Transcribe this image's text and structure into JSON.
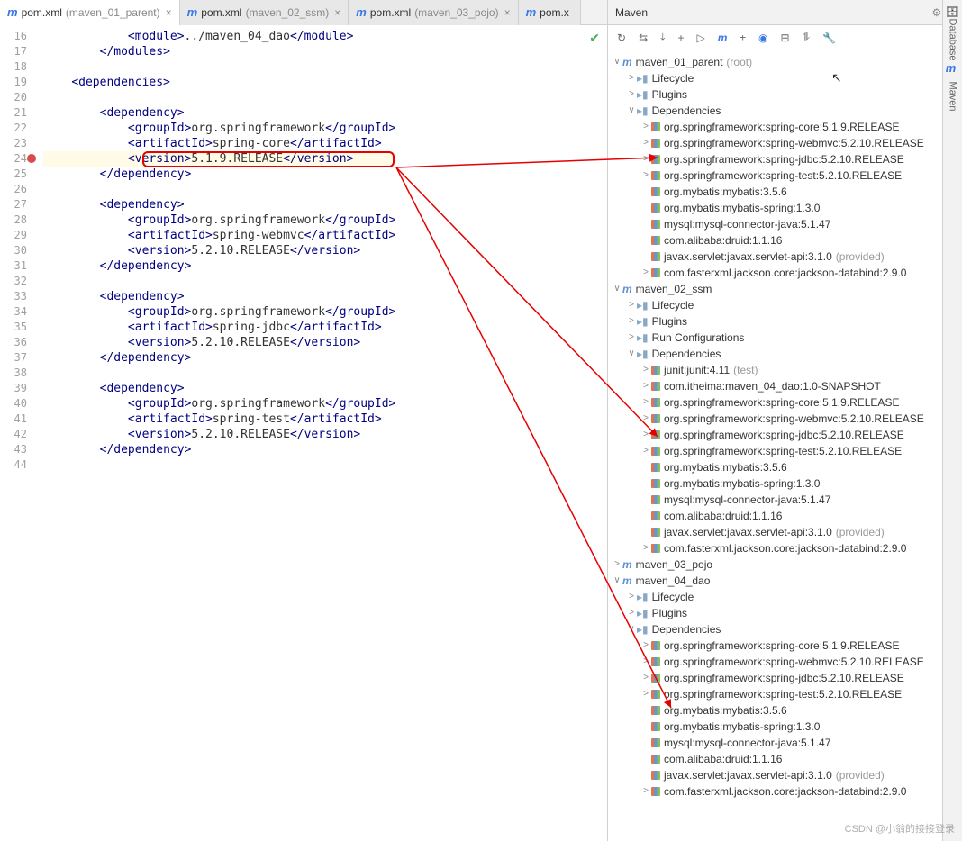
{
  "editor": {
    "tabs": [
      {
        "label": "pom.xml",
        "sub": "(maven_01_parent)",
        "active": true
      },
      {
        "label": "pom.xml",
        "sub": "(maven_02_ssm)",
        "active": false
      },
      {
        "label": "pom.xml",
        "sub": "(maven_03_pojo)",
        "active": false
      },
      {
        "label": "pom.x",
        "sub": "",
        "active": false
      }
    ],
    "lineStart": 16,
    "errorLine": 24,
    "highlightedVersion": "5.1.9.RELEASE",
    "deps": [
      {
        "group": "org.springframework",
        "artifact": "spring-core",
        "version": "5.1.9.RELEASE"
      },
      {
        "group": "org.springframework",
        "artifact": "spring-webmvc",
        "version": "5.2.10.RELEASE"
      },
      {
        "group": "org.springframework",
        "artifact": "spring-jdbc",
        "version": "5.2.10.RELEASE"
      },
      {
        "group": "org.springframework",
        "artifact": "spring-test",
        "version": "5.2.10.RELEASE"
      }
    ]
  },
  "maven": {
    "title": "Maven",
    "toolbar": [
      "↻",
      "⇆",
      "⤓",
      "+",
      "▷",
      "m",
      "±",
      "◉",
      "⊞",
      "⥮",
      "🔧"
    ],
    "tree": {
      "root1": {
        "name": "maven_01_parent",
        "suffix": "(root)",
        "lifecycle": "Lifecycle",
        "plugins": "Plugins",
        "depsLabel": "Dependencies",
        "deps": [
          {
            "txt": "org.springframework:spring-core:5.1.9.RELEASE",
            "exp": true
          },
          {
            "txt": "org.springframework:spring-webmvc:5.2.10.RELEASE",
            "exp": true
          },
          {
            "txt": "org.springframework:spring-jdbc:5.2.10.RELEASE",
            "exp": true
          },
          {
            "txt": "org.springframework:spring-test:5.2.10.RELEASE",
            "exp": true
          },
          {
            "txt": "org.mybatis:mybatis:3.5.6"
          },
          {
            "txt": "org.mybatis:mybatis-spring:1.3.0"
          },
          {
            "txt": "mysql:mysql-connector-java:5.1.47"
          },
          {
            "txt": "com.alibaba:druid:1.1.16"
          },
          {
            "txt": "javax.servlet:javax.servlet-api:3.1.0",
            "dim": "(provided)"
          },
          {
            "txt": "com.fasterxml.jackson.core:jackson-databind:2.9.0",
            "exp": true
          }
        ]
      },
      "root2": {
        "name": "maven_02_ssm",
        "lifecycle": "Lifecycle",
        "plugins": "Plugins",
        "runcfg": "Run Configurations",
        "depsLabel": "Dependencies",
        "deps": [
          {
            "txt": "junit:junit:4.11",
            "dim": "(test)",
            "exp": true
          },
          {
            "txt": "com.itheima:maven_04_dao:1.0-SNAPSHOT",
            "exp": true
          },
          {
            "txt": "org.springframework:spring-core:5.1.9.RELEASE",
            "exp": true
          },
          {
            "txt": "org.springframework:spring-webmvc:5.2.10.RELEASE",
            "exp": true
          },
          {
            "txt": "org.springframework:spring-jdbc:5.2.10.RELEASE",
            "exp": true
          },
          {
            "txt": "org.springframework:spring-test:5.2.10.RELEASE",
            "exp": true
          },
          {
            "txt": "org.mybatis:mybatis:3.5.6"
          },
          {
            "txt": "org.mybatis:mybatis-spring:1.3.0"
          },
          {
            "txt": "mysql:mysql-connector-java:5.1.47"
          },
          {
            "txt": "com.alibaba:druid:1.1.16"
          },
          {
            "txt": "javax.servlet:javax.servlet-api:3.1.0",
            "dim": "(provided)"
          },
          {
            "txt": "com.fasterxml.jackson.core:jackson-databind:2.9.0",
            "exp": true
          }
        ]
      },
      "root3": {
        "name": "maven_03_pojo"
      },
      "root4": {
        "name": "maven_04_dao",
        "lifecycle": "Lifecycle",
        "plugins": "Plugins",
        "depsLabel": "Dependencies",
        "deps": [
          {
            "txt": "org.springframework:spring-core:5.1.9.RELEASE",
            "exp": true
          },
          {
            "txt": "org.springframework:spring-webmvc:5.2.10.RELEASE",
            "exp": true
          },
          {
            "txt": "org.springframework:spring-jdbc:5.2.10.RELEASE",
            "exp": true
          },
          {
            "txt": "org.springframework:spring-test:5.2.10.RELEASE",
            "exp": true
          },
          {
            "txt": "org.mybatis:mybatis:3.5.6"
          },
          {
            "txt": "org.mybatis:mybatis-spring:1.3.0"
          },
          {
            "txt": "mysql:mysql-connector-java:5.1.47"
          },
          {
            "txt": "com.alibaba:druid:1.1.16"
          },
          {
            "txt": "javax.servlet:javax.servlet-api:3.1.0",
            "dim": "(provided)"
          },
          {
            "txt": "com.fasterxml.jackson.core:jackson-databind:2.9.0",
            "exp": true
          }
        ]
      }
    }
  },
  "rail": {
    "db": "Database",
    "mvn": "Maven"
  },
  "watermark": "CSDN @小翁的接接登录"
}
